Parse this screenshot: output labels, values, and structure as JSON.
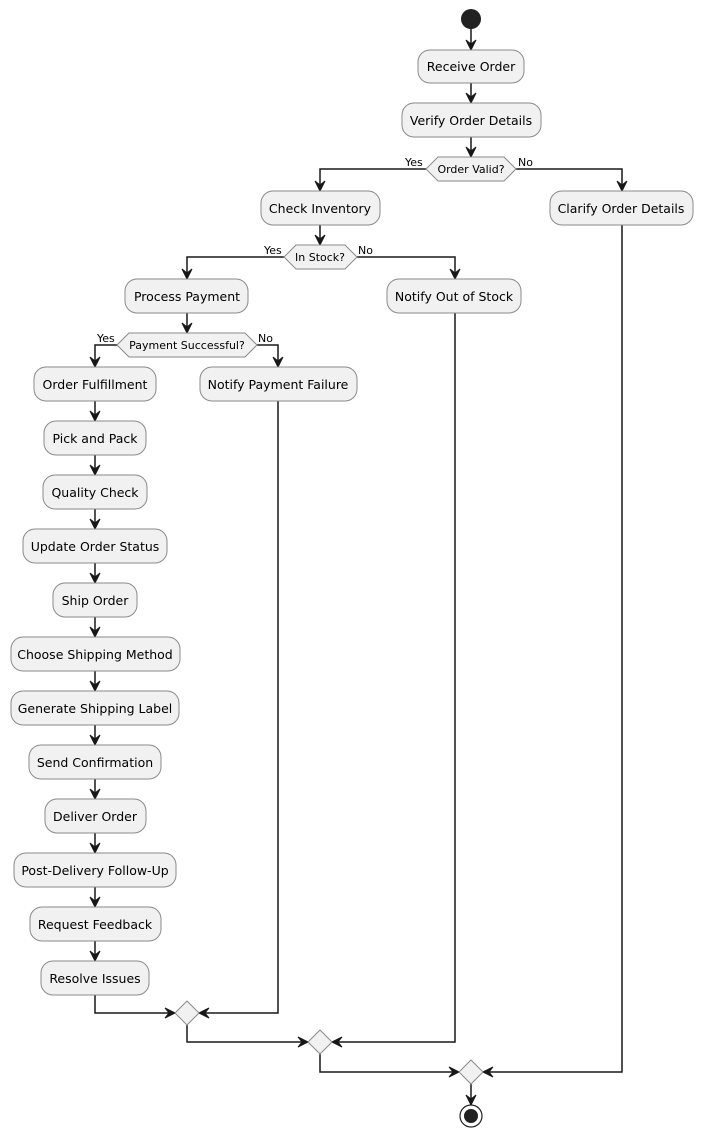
{
  "diagram": {
    "type": "activity",
    "start": "start",
    "end": "end",
    "actions": {
      "receive_order": "Receive Order",
      "verify_order_details": "Verify Order Details",
      "check_inventory": "Check Inventory",
      "clarify_order_details": "Clarify Order Details",
      "process_payment": "Process Payment",
      "notify_out_of_stock": "Notify Out of Stock",
      "notify_payment_failure": "Notify Payment Failure",
      "order_fulfillment": "Order Fulfillment",
      "pick_and_pack": "Pick and Pack",
      "quality_check": "Quality Check",
      "update_order_status": "Update Order Status",
      "ship_order": "Ship Order",
      "choose_shipping_method": "Choose Shipping Method",
      "generate_shipping_label": "Generate Shipping Label",
      "send_confirmation": "Send Confirmation",
      "deliver_order": "Deliver Order",
      "post_delivery_follow_up": "Post-Delivery Follow-Up",
      "request_feedback": "Request Feedback",
      "resolve_issues": "Resolve Issues"
    },
    "decisions": {
      "order_valid": {
        "label": "Order Valid?",
        "yes": "Yes",
        "no": "No"
      },
      "in_stock": {
        "label": "In Stock?",
        "yes": "Yes",
        "no": "No"
      },
      "payment_successful": {
        "label": "Payment Successful?",
        "yes": "Yes",
        "no": "No"
      }
    },
    "fulfillment_sequence": [
      "Order Fulfillment",
      "Pick and Pack",
      "Quality Check",
      "Update Order Status",
      "Ship Order",
      "Choose Shipping Method",
      "Generate Shipping Label",
      "Send Confirmation",
      "Deliver Order",
      "Post-Delivery Follow-Up",
      "Request Feedback",
      "Resolve Issues"
    ],
    "colors": {
      "node_fill": "#f1f1f1",
      "node_border": "#8a8a8a",
      "edge": "#181818",
      "start_end": "#222222"
    }
  }
}
